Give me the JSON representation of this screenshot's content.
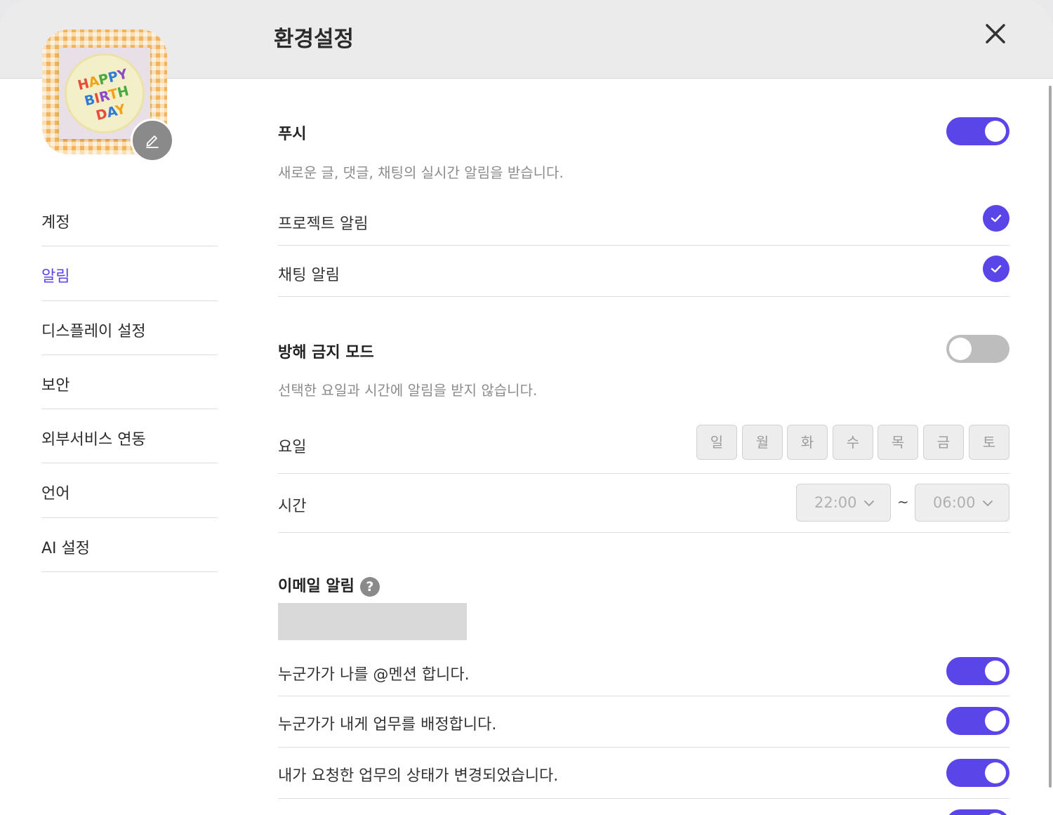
{
  "header": {
    "title": "환경설정"
  },
  "sidebar": {
    "avatar_text": "HAPPY BIRTHDAY",
    "items": [
      {
        "label": "계정",
        "active": false
      },
      {
        "label": "알림",
        "active": true
      },
      {
        "label": "디스플레이 설정",
        "active": false
      },
      {
        "label": "보안",
        "active": false
      },
      {
        "label": "외부서비스 연동",
        "active": false
      },
      {
        "label": "언어",
        "active": false
      },
      {
        "label": "AI 설정",
        "active": false
      }
    ]
  },
  "push": {
    "title": "푸시",
    "enabled": true,
    "description": "새로운 글, 댓글, 채팅의 실시간 알림을 받습니다.",
    "options": [
      {
        "label": "프로젝트 알림",
        "checked": true
      },
      {
        "label": "채팅 알림",
        "checked": true
      }
    ]
  },
  "dnd": {
    "title": "방해 금지 모드",
    "enabled": false,
    "description": "선택한 요일과 시간에 알림을 받지 않습니다.",
    "days_label": "요일",
    "days": [
      "일",
      "월",
      "화",
      "수",
      "목",
      "금",
      "토"
    ],
    "time_label": "시간",
    "start_time": "22:00",
    "separator": "~",
    "end_time": "06:00"
  },
  "email": {
    "title": "이메일 알림",
    "help_icon": "?",
    "options": [
      {
        "label": "누군가가 나를 @멘션 합니다.",
        "enabled": true
      },
      {
        "label": "누군가가 내게 업무를 배정합니다.",
        "enabled": true
      },
      {
        "label": "내가 요청한 업무의 상태가 변경되었습니다.",
        "enabled": true
      }
    ]
  },
  "colors": {
    "accent": "#5a45e8",
    "toggle_off": "#bdbdbd",
    "header_bg": "#ebebeb",
    "muted_text": "#8c8c8c"
  },
  "icons": {
    "close": "close-icon",
    "edit_avatar": "pencil-icon",
    "check": "checkmark-icon",
    "dropdown": "chevron-down-icon",
    "help": "question-icon"
  }
}
